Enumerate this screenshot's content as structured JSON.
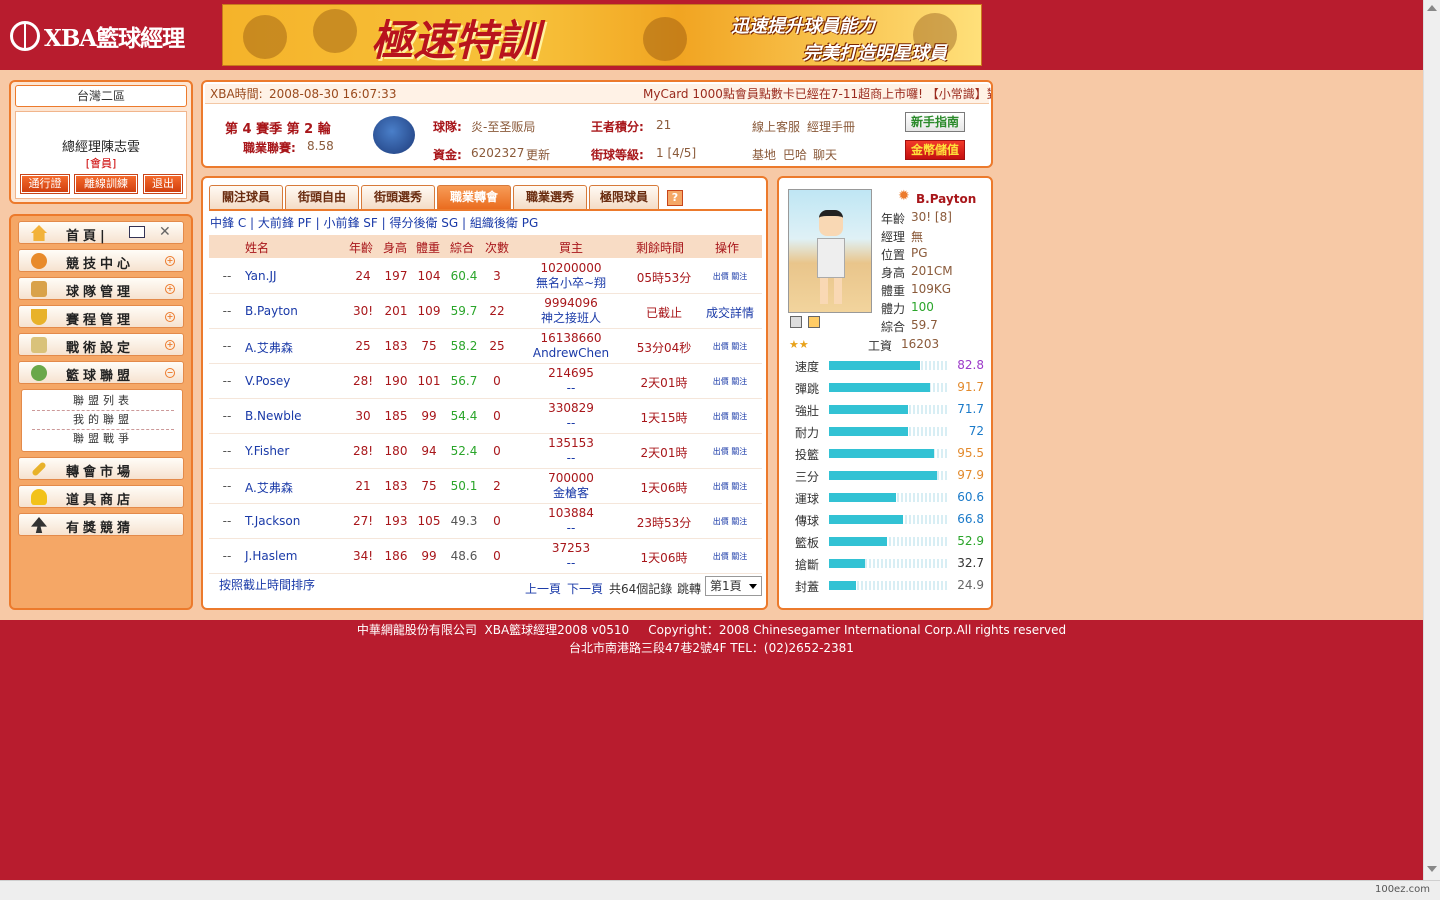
{
  "header": {
    "logo_text": "XBA籃球經理",
    "banner_main": "極速特訓",
    "banner_line1": "迅速提升球員能力",
    "banner_line2": "完美打造明星球員"
  },
  "region": "台灣二區",
  "manager": {
    "name": "總經理陳志雲",
    "role": "[會員]"
  },
  "manager_buttons": [
    "通行證",
    "離線訓練",
    "退出"
  ],
  "nav": {
    "home": "首頁|",
    "items": [
      "競技中心",
      "球隊管理",
      "賽程管理",
      "戰術設定",
      "籃球聯盟"
    ],
    "sub_items": [
      "聯盟列表",
      "我的聯盟",
      "聯盟戰爭"
    ],
    "items2": [
      "轉會市場",
      "道具商店",
      "有獎競猜"
    ]
  },
  "info": {
    "time_label": "XBA時間:",
    "time": "2008-08-30 16:07:33",
    "ticker": "MyCard 1000點會員點數卡已經在7-11超商上市囉! 【小常識】對",
    "season": "第 4 賽季 第 2 輪",
    "league_label": "職業聯賽:",
    "league_value": "8.58",
    "team_label": "球隊:",
    "team_value": "炎-至圣贩局",
    "funds_label": "資金:",
    "funds_value": "6202327",
    "funds_update": "更新",
    "points_label": "王者積分:",
    "points_value": "21",
    "level_label": "街球等級:",
    "level_value": "1 [4/5]",
    "links1": [
      "線上客服",
      "經理手冊"
    ],
    "links2": [
      "基地",
      "巴哈",
      "聊天"
    ],
    "btn_guide": "新手指南",
    "btn_topup": "金幣儲值"
  },
  "market": {
    "tabs": [
      "關注球員",
      "街頭自由",
      "街頭選秀",
      "職業轉會",
      "職業選秀",
      "極限球員"
    ],
    "help": "?",
    "positions": "中鋒 C | 大前鋒 PF | 小前鋒 SF | 得分後衛 SG | 組織後衛 PG",
    "headers": [
      "姓名",
      "年齡",
      "身高",
      "體重",
      "綜合",
      "次數",
      "買主",
      "剩餘時間",
      "操作"
    ],
    "rows": [
      {
        "mark": "--",
        "name": "Yan.JJ",
        "age": "24",
        "height": "197",
        "weight": "104",
        "overall": "60.4",
        "count": "3",
        "price": "10200000",
        "buyer": "無名小卒~翔",
        "remain": "05時53分",
        "op": "出價 關注"
      },
      {
        "mark": "--",
        "name": "B.Payton",
        "age": "30!",
        "height": "201",
        "weight": "109",
        "overall": "59.7",
        "count": "22",
        "price": "9994096",
        "buyer": "神之接班人",
        "remain": "已截止",
        "op": "成交詳情"
      },
      {
        "mark": "--",
        "name": "A.艾弗森",
        "age": "25",
        "height": "183",
        "weight": "75",
        "overall": "58.2",
        "count": "25",
        "price": "16138660",
        "buyer": "AndrewChen",
        "remain": "53分04秒",
        "op": "出價 關注"
      },
      {
        "mark": "--",
        "name": "V.Posey",
        "age": "28!",
        "height": "190",
        "weight": "101",
        "overall": "56.7",
        "count": "0",
        "price": "214695",
        "buyer": "--",
        "remain": "2天01時",
        "op": "出價 關注"
      },
      {
        "mark": "--",
        "name": "B.Newble",
        "age": "30",
        "height": "185",
        "weight": "99",
        "overall": "54.4",
        "count": "0",
        "price": "330829",
        "buyer": "--",
        "remain": "1天15時",
        "op": "出價 關注"
      },
      {
        "mark": "--",
        "name": "Y.Fisher",
        "age": "28!",
        "height": "180",
        "weight": "94",
        "overall": "52.4",
        "count": "0",
        "price": "135153",
        "buyer": "--",
        "remain": "2天01時",
        "op": "出價 關注"
      },
      {
        "mark": "--",
        "name": "A.艾弗森",
        "age": "21",
        "height": "183",
        "weight": "75",
        "overall": "50.1",
        "count": "2",
        "price": "700000",
        "buyer": "金槍客",
        "remain": "1天06時",
        "op": "出價 關注"
      },
      {
        "mark": "--",
        "name": "T.Jackson",
        "age": "27!",
        "height": "193",
        "weight": "105",
        "overall": "49.3",
        "count": "0",
        "price": "103884",
        "buyer": "--",
        "remain": "23時53分",
        "op": "出價 關注"
      },
      {
        "mark": "--",
        "name": "J.Haslem",
        "age": "34!",
        "height": "186",
        "weight": "99",
        "overall": "48.6",
        "count": "0",
        "price": "37253",
        "buyer": "--",
        "remain": "1天06時",
        "op": "出價 關注"
      }
    ],
    "sort_link": "按照截止時間排序",
    "prev": "上一頁",
    "next": "下一頁",
    "total": "共64個記錄",
    "jump": "跳轉",
    "page": "第1頁"
  },
  "player": {
    "name": "B.Payton",
    "fields": [
      {
        "k": "年齡",
        "v": "30! [8]"
      },
      {
        "k": "經理",
        "v": "無"
      },
      {
        "k": "位置",
        "v": "PG"
      },
      {
        "k": "身高",
        "v": "201CM"
      },
      {
        "k": "體重",
        "v": "109KG"
      },
      {
        "k": "體力",
        "v": "100"
      },
      {
        "k": "綜合",
        "v": "59.7"
      }
    ],
    "salary_label": "工資",
    "salary": "16203",
    "stats": [
      {
        "k": "速度",
        "v": "82.8",
        "color": "#9c3ac9"
      },
      {
        "k": "彈跳",
        "v": "91.7",
        "color": "#e38a2c"
      },
      {
        "k": "強壯",
        "v": "71.7",
        "color": "#1a7ac9"
      },
      {
        "k": "耐力",
        "v": "72",
        "color": "#1a7ac9"
      },
      {
        "k": "投籃",
        "v": "95.5",
        "color": "#e38a2c"
      },
      {
        "k": "三分",
        "v": "97.9",
        "color": "#e38a2c"
      },
      {
        "k": "運球",
        "v": "60.6",
        "color": "#1a7ac9"
      },
      {
        "k": "傳球",
        "v": "66.8",
        "color": "#1a7ac9"
      },
      {
        "k": "籃板",
        "v": "52.9",
        "color": "#2aa52a"
      },
      {
        "k": "搶斷",
        "v": "32.7",
        "color": "#333333"
      },
      {
        "k": "封蓋",
        "v": "24.9",
        "color": "#666666"
      }
    ]
  },
  "footer": {
    "line1": "中華網龍股份有限公司  XBA籃球經理2008 v0510     Copyright：2008 Chinesegamer International Corp.All rights reserved",
    "line2": "台北市南港路三段47巷2號4F TEL：(02)2652-2381"
  },
  "statusbar": {
    "watermark": "100ez.com"
  }
}
